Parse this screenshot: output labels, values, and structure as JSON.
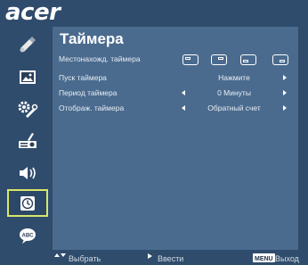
{
  "brand": {
    "logo_text": "acer"
  },
  "menu": {
    "title": "Таймера",
    "rows": [
      {
        "label": "Местонахожд. таймера"
      },
      {
        "label": "Пуск таймера",
        "value": "Нажмите"
      },
      {
        "label": "Период таймера",
        "value": "0  Минуты"
      },
      {
        "label": "Отображ. таймера",
        "value": "Обратный счет"
      }
    ],
    "location_options": [
      "top-left",
      "top-right",
      "bottom-left",
      "bottom-right"
    ]
  },
  "sidebar": {
    "items": [
      {
        "icon": "color-settings-icon"
      },
      {
        "icon": "image-settings-icon"
      },
      {
        "icon": "management-icon"
      },
      {
        "icon": "projector-settings-icon"
      },
      {
        "icon": "audio-icon"
      },
      {
        "icon": "timer-icon",
        "active": true
      },
      {
        "icon": "language-icon"
      }
    ]
  },
  "footer": {
    "select_label": "Выбрать",
    "enter_label": "Ввести",
    "menu_key": "MENU",
    "exit_label": "Выход"
  },
  "colors": {
    "background": "#2f4c6c",
    "panel": "#4a6b8e",
    "active_border": "#d8e66a",
    "text": "#ffffff"
  }
}
